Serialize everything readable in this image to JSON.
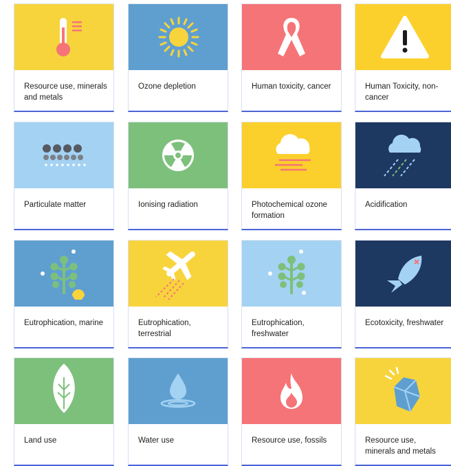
{
  "colors": {
    "yellow": "#f8d43c",
    "blue": "#5f9fd0",
    "coral": "#f57477",
    "light_blue": "#a4d2f3",
    "green": "#7dc07c",
    "navy": "#1d3861",
    "accent_border": "#4a63d6"
  },
  "cards": [
    {
      "label": "Resource use, minerals and metals",
      "icon": "thermometer-icon",
      "bg": "#f8d43c"
    },
    {
      "label": "Ozone depletion",
      "icon": "sun-icon",
      "bg": "#5f9fd0"
    },
    {
      "label": "Human toxicity, cancer",
      "icon": "ribbon-icon",
      "bg": "#f57477"
    },
    {
      "label": "Human Toxicity, non-cancer",
      "icon": "warning-icon",
      "bg": "#fcd02c"
    },
    {
      "label": "Particulate matter",
      "icon": "particles-icon",
      "bg": "#a4d2f3"
    },
    {
      "label": "Ionising radiation",
      "icon": "radiation-icon",
      "bg": "#7dc07c"
    },
    {
      "label": "Photochemical ozone formation",
      "icon": "smog-cloud-icon",
      "bg": "#fcd02c"
    },
    {
      "label": "Acidification",
      "icon": "acid-rain-icon",
      "bg": "#1d3861"
    },
    {
      "label": "Eutrophication, marine",
      "icon": "algae-shell-icon",
      "bg": "#5f9fd0"
    },
    {
      "label": "Eutrophication, terrestrial",
      "icon": "airplane-icon",
      "bg": "#f8d43c"
    },
    {
      "label": "Eutrophication, freshwater",
      "icon": "algae-icon",
      "bg": "#a4d2f3"
    },
    {
      "label": "Ecotoxicity, freshwater",
      "icon": "fish-icon",
      "bg": "#1d3861"
    },
    {
      "label": "Land use",
      "icon": "leaf-icon",
      "bg": "#7dc07c"
    },
    {
      "label": "Water use",
      "icon": "water-drop-icon",
      "bg": "#5f9fd0"
    },
    {
      "label": "Resource use, fossils",
      "icon": "fire-icon",
      "bg": "#f57477"
    },
    {
      "label": "Resource use, minerals and metals",
      "icon": "gem-icon",
      "bg": "#f8d43c"
    }
  ]
}
